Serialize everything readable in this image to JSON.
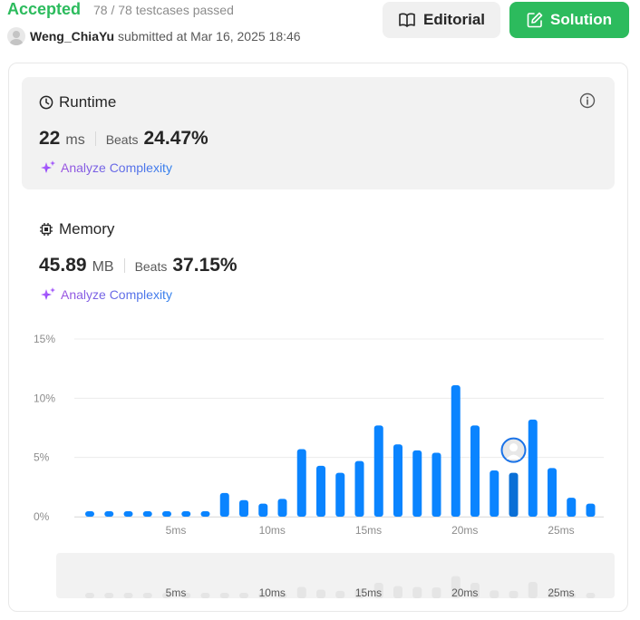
{
  "header": {
    "status": "Accepted",
    "testcases": "78 / 78 testcases passed",
    "username": "Weng_ChiaYu",
    "submitted": "submitted at Mar 16, 2025 18:46",
    "editorial_label": "Editorial",
    "solution_label": "Solution"
  },
  "runtime": {
    "title": "Runtime",
    "value": "22",
    "unit": "ms",
    "beats_label": "Beats",
    "beats_value": "24.47%",
    "analyze_label": "Analyze Complexity"
  },
  "memory": {
    "title": "Memory",
    "value": "45.89",
    "unit": "MB",
    "beats_label": "Beats",
    "beats_value": "37.15%",
    "analyze_label": "Analyze Complexity"
  },
  "colors": {
    "accepted": "#2cbb5d",
    "bar": "#0a84ff",
    "bar_selected": "#0a6fd6",
    "minimap_bar": "#e5e5e5"
  },
  "chart_data": {
    "type": "bar",
    "x": [
      1,
      2,
      3,
      4,
      5,
      6,
      7,
      8,
      9,
      10,
      11,
      12,
      13,
      14,
      15,
      16,
      17,
      18,
      19,
      20,
      21,
      22,
      23,
      24,
      25,
      26
    ],
    "values": [
      0.4,
      0.4,
      0.4,
      0.4,
      0.4,
      0.4,
      0.4,
      2.0,
      1.4,
      1.1,
      1.5,
      5.7,
      4.3,
      3.7,
      4.7,
      7.7,
      6.1,
      5.6,
      5.4,
      11.1,
      7.7,
      3.9,
      3.7,
      8.2,
      4.1,
      1.6,
      1.1
    ],
    "x_values": [
      1,
      2,
      3,
      4,
      5,
      6,
      7,
      8,
      9,
      10,
      11,
      12,
      13,
      14,
      15,
      16,
      17,
      18,
      19,
      20,
      21,
      22,
      23,
      24,
      25,
      26,
      27
    ],
    "selected_x": 23,
    "yticks": [
      "0%",
      "5%",
      "10%",
      "15%"
    ],
    "ytick_values": [
      0,
      5,
      10,
      15
    ],
    "xticks": [
      "5ms",
      "10ms",
      "15ms",
      "20ms",
      "25ms"
    ],
    "xtick_values": [
      5,
      10,
      15,
      20,
      25
    ],
    "ylim": [
      0,
      15
    ],
    "grid": true
  }
}
